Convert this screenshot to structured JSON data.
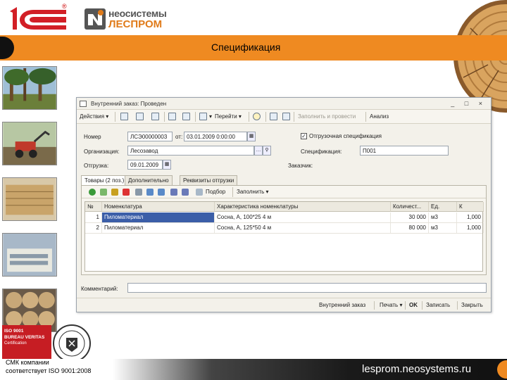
{
  "slide": {
    "title": "Спецификация",
    "brand_top": "неосистемы",
    "brand_bottom": "ЛЕСПРОМ",
    "logo_1c": "1С",
    "logo_reg": "®",
    "cert_iso": "ISO 9001",
    "cert_bv": "BUREAU VERITAS",
    "cert_cert": "Certification",
    "cmk_line1": "СМК компании",
    "cmk_line2": "соответствует ISO 9001:2008",
    "url": "lesprom.neosystems.ru",
    "colors": {
      "accent": "#ef8a21",
      "cert_red": "#c61d23",
      "selection": "#3b5ea8"
    }
  },
  "window": {
    "title": "Внутренний заказ: Проведен",
    "controls": "_ □ ×",
    "toolbar": {
      "actions": "Действия",
      "goto": "Перейти",
      "fill_and_post": "Заполнить и провести",
      "analysis": "Анализ"
    },
    "form": {
      "number_label": "Номер",
      "number_value": "ЛСЭ00000003",
      "from_label": "от:",
      "date_value": "03.01.2009 0:00:00",
      "shipping_spec_label": "Отгрузочная спецификация",
      "shipping_spec_checked": true,
      "org_label": "Организация:",
      "org_value": "Лесозавод",
      "spec_label": "Спецификация:",
      "spec_value": "П001",
      "shipment_label": "Отгрузка:",
      "shipment_value": "09.01.2009",
      "customer_label": "Заказчик:"
    },
    "tabs": [
      "Товары (2 поз.)",
      "Дополнительно",
      "Реквизиты отгрузки"
    ],
    "inner_toolbar": {
      "pick": "Подбор",
      "fill": "Заполнить"
    },
    "grid": {
      "headers": [
        "№",
        "Номенклатура",
        "Характеристика номенклатуры",
        "Количест...",
        "Ед.",
        "К"
      ],
      "rows": [
        [
          "1",
          "Пиломатериал",
          "Сосна, А, 100*25 4 м",
          "30 000",
          "м3",
          "1,000"
        ],
        [
          "2",
          "Пиломатериал",
          "Сосна, А, 125*50 4 м",
          "80 000",
          "м3",
          "1,000"
        ]
      ]
    },
    "comment_label": "Комментарий:",
    "bottom": {
      "internal_order": "Внутренний заказ",
      "print": "Печать",
      "ok": "OK",
      "save": "Записать",
      "close": "Закрыть"
    }
  }
}
